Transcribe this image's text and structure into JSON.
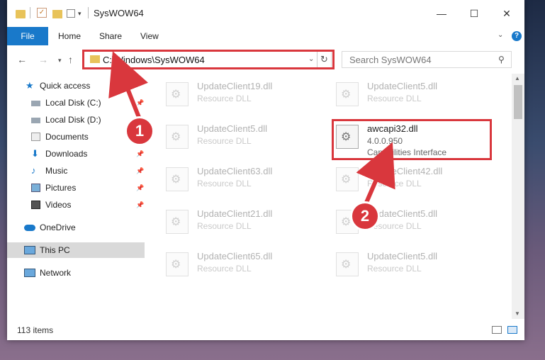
{
  "window": {
    "title": "SysWOW64"
  },
  "window_controls": {
    "minimize": "—",
    "maximize": "☐",
    "close": "✕"
  },
  "ribbon": {
    "tabs": [
      "File",
      "Home",
      "Share",
      "View"
    ]
  },
  "navigation": {
    "address": "C:\\Windows\\SysWOW64",
    "search_placeholder": "Search SysWOW64"
  },
  "sidebar": {
    "items": [
      {
        "label": "Quick access",
        "icon": "star-icon"
      },
      {
        "label": "Local Disk (C:)",
        "icon": "drive-icon",
        "pinned": true
      },
      {
        "label": "Local Disk (D:)",
        "icon": "drive-icon"
      },
      {
        "label": "Documents",
        "icon": "documents-icon"
      },
      {
        "label": "Downloads",
        "icon": "download-icon",
        "pinned": true
      },
      {
        "label": "Music",
        "icon": "music-icon",
        "pinned": true
      },
      {
        "label": "Pictures",
        "icon": "pictures-icon",
        "pinned": true
      },
      {
        "label": "Videos",
        "icon": "videos-icon",
        "pinned": true
      },
      {
        "label": "OneDrive",
        "icon": "cloud-icon"
      },
      {
        "label": "This PC",
        "icon": "computer-icon",
        "selected": true
      },
      {
        "label": "Network",
        "icon": "network-icon"
      }
    ]
  },
  "files": [
    {
      "name": "UpdateClient19.dll",
      "desc": "Resource DLL"
    },
    {
      "name": "UpdateClient5.dll",
      "desc": "Resource DLL"
    },
    {
      "name": "UpdateClient5.dll",
      "desc": "Resource DLL"
    },
    {
      "name": "awcapi32.dll",
      "version": "4.0.0.950",
      "desc": "Capabilities Interface"
    },
    {
      "name": "UpdateClient63.dll",
      "desc": "Resource DLL"
    },
    {
      "name": "UpdateClient42.dll",
      "desc": "Resource DLL"
    },
    {
      "name": "UpdateClient21.dll",
      "desc": "Resource DLL"
    },
    {
      "name": "UpdateClient5.dll",
      "desc": "Resource DLL"
    },
    {
      "name": "UpdateClient65.dll",
      "desc": "Resource DLL"
    },
    {
      "name": "UpdateClient5.dll",
      "desc": "Resource DLL"
    }
  ],
  "status": {
    "item_count": "113 items"
  },
  "annotations": {
    "step1": "1",
    "step2": "2"
  },
  "colors": {
    "accent": "#1979ca",
    "highlight": "#d9373d"
  }
}
